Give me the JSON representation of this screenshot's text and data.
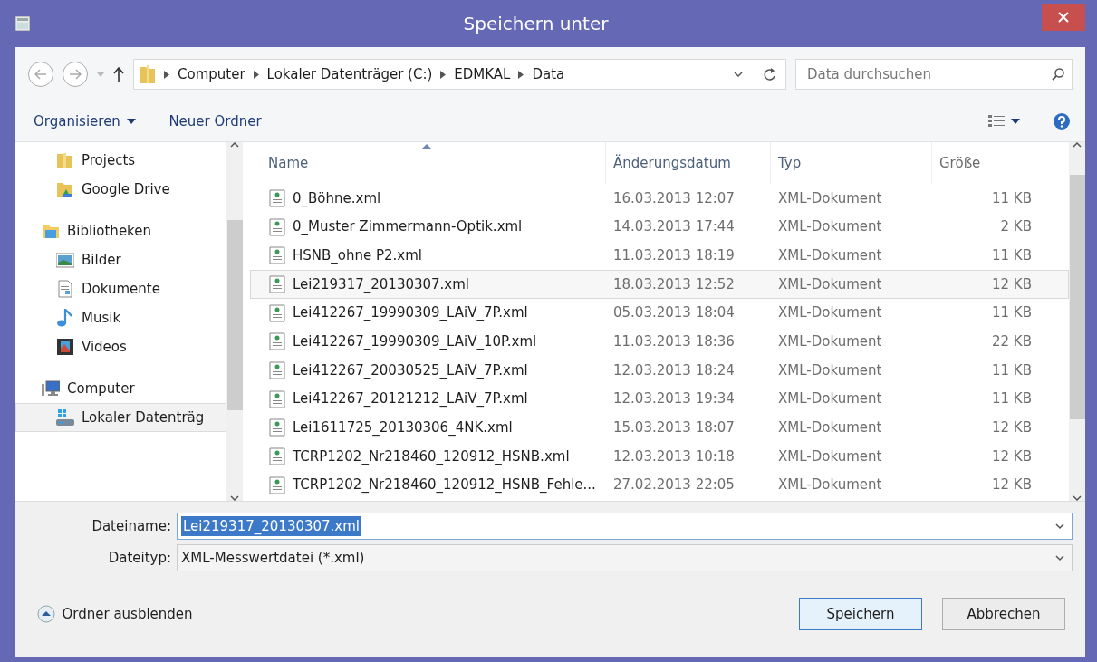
{
  "window": {
    "title": "Speichern unter"
  },
  "address": {
    "crumbs": [
      "Computer",
      "Lokaler Datenträger (C:)",
      "EDMKAL",
      "Data"
    ]
  },
  "search": {
    "placeholder": "Data durchsuchen"
  },
  "toolbar": {
    "organize": "Organisieren",
    "new_folder": "Neuer Ordner"
  },
  "sidebar": {
    "groups": [
      {
        "items": [
          {
            "label": "Projects",
            "kind": "folder",
            "selected": false
          },
          {
            "label": "Google Drive",
            "kind": "drive",
            "selected": false
          }
        ]
      },
      {
        "label": "Bibliotheken",
        "kind": "library",
        "items": [
          {
            "label": "Bilder",
            "kind": "pictures",
            "selected": false
          },
          {
            "label": "Dokumente",
            "kind": "documents",
            "selected": false
          },
          {
            "label": "Musik",
            "kind": "music",
            "selected": false
          },
          {
            "label": "Videos",
            "kind": "videos",
            "selected": false
          }
        ]
      },
      {
        "label": "Computer",
        "kind": "computer",
        "items": [
          {
            "label": "Lokaler Datenträg",
            "kind": "disk",
            "selected": true
          }
        ]
      }
    ]
  },
  "table": {
    "columns": [
      "Name",
      "Änderungsdatum",
      "Typ",
      "Größe"
    ],
    "rows": [
      {
        "name": "0_Böhne.xml",
        "date": "16.03.2013 12:07",
        "type": "XML-Dokument",
        "size": "11 KB",
        "selected": false
      },
      {
        "name": "0_Muster Zimmermann-Optik.xml",
        "date": "14.03.2013 17:44",
        "type": "XML-Dokument",
        "size": "2 KB",
        "selected": false
      },
      {
        "name": "HSNB_ohne P2.xml",
        "date": "11.03.2013 18:19",
        "type": "XML-Dokument",
        "size": "11 KB",
        "selected": false
      },
      {
        "name": "Lei219317_20130307.xml",
        "date": "18.03.2013 12:52",
        "type": "XML-Dokument",
        "size": "12 KB",
        "selected": true
      },
      {
        "name": "Lei412267_19990309_LAiV_7P.xml",
        "date": "05.03.2013 18:04",
        "type": "XML-Dokument",
        "size": "11 KB",
        "selected": false
      },
      {
        "name": "Lei412267_19990309_LAiV_10P.xml",
        "date": "11.03.2013 18:36",
        "type": "XML-Dokument",
        "size": "22 KB",
        "selected": false
      },
      {
        "name": "Lei412267_20030525_LAiV_7P.xml",
        "date": "12.03.2013 18:24",
        "type": "XML-Dokument",
        "size": "11 KB",
        "selected": false
      },
      {
        "name": "Lei412267_20121212_LAiV_7P.xml",
        "date": "12.03.2013 19:34",
        "type": "XML-Dokument",
        "size": "11 KB",
        "selected": false
      },
      {
        "name": "Lei1611725_20130306_4NK.xml",
        "date": "15.03.2013 18:07",
        "type": "XML-Dokument",
        "size": "12 KB",
        "selected": false
      },
      {
        "name": "TCRP1202_Nr218460_120912_HSNB.xml",
        "date": "12.03.2013 10:18",
        "type": "XML-Dokument",
        "size": "12 KB",
        "selected": false
      },
      {
        "name": "TCRP1202_Nr218460_120912_HSNB_Fehle...",
        "date": "27.02.2013 22:05",
        "type": "XML-Dokument",
        "size": "12 KB",
        "selected": false
      }
    ]
  },
  "filename": {
    "label": "Dateiname:",
    "value": "Lei219317_20130307.xml"
  },
  "filetype": {
    "label": "Dateityp:",
    "value": "XML-Messwertdatei (*.xml)"
  },
  "hide_folders": "Ordner ausblenden",
  "buttons": [
    "Speichern",
    "Abbrechen"
  ]
}
